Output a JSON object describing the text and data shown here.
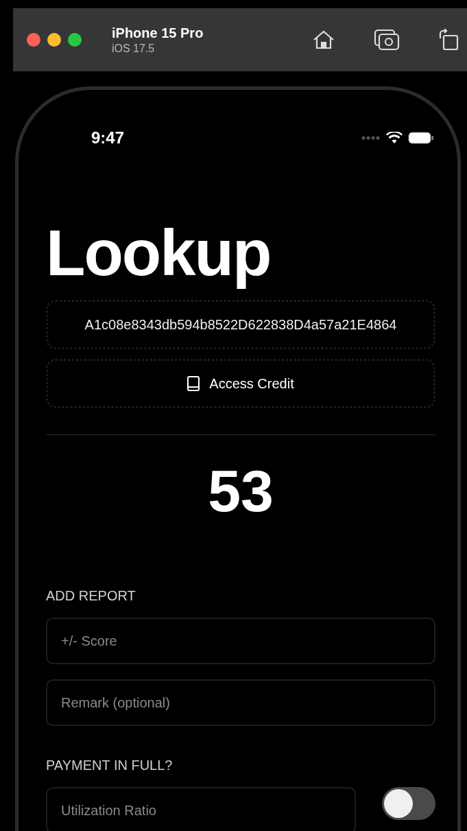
{
  "simulator": {
    "device": "iPhone 15 Pro",
    "os": "iOS 17.5"
  },
  "status_bar": {
    "time": "9:47"
  },
  "title": "Lookup",
  "address_field": {
    "value": "A1c08e8343db594b8522D622838D4a57a21E4864"
  },
  "access_button": {
    "label": "Access Credit"
  },
  "score": "53",
  "add_report": {
    "header": "ADD REPORT",
    "fields": [
      {
        "placeholder": "+/- Score"
      },
      {
        "placeholder": "Remark (optional)"
      }
    ]
  },
  "payment": {
    "header": "PAYMENT IN FULL?",
    "field": {
      "placeholder": "Utilization Ratio"
    },
    "toggle": {
      "on": false
    }
  }
}
